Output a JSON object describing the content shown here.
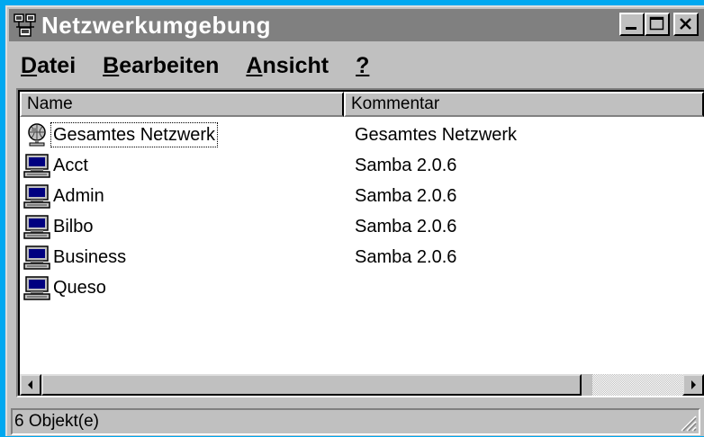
{
  "window": {
    "title": "Netzwerkumgebung",
    "title_icon": "network-neighborhood-icon",
    "buttons": [
      "minimize-icon",
      "maximize-icon",
      "close-icon"
    ]
  },
  "menu": {
    "items": [
      {
        "underline": "D",
        "rest": "atei"
      },
      {
        "underline": "B",
        "rest": "earbeiten"
      },
      {
        "underline": "A",
        "rest": "nsicht"
      },
      {
        "underline": "?",
        "rest": ""
      }
    ]
  },
  "list": {
    "columns": [
      "Name",
      "Kommentar"
    ],
    "rows": [
      {
        "name": "Gesamtes Netzwerk",
        "comment": "Gesamtes Netzwerk",
        "icon": "globe-network-icon"
      },
      {
        "name": "Acct",
        "comment": "Samba 2.0.6",
        "icon": "computer-icon"
      },
      {
        "name": "Admin",
        "comment": "Samba 2.0.6",
        "icon": "computer-icon"
      },
      {
        "name": "Bilbo",
        "comment": "Samba 2.0.6",
        "icon": "computer-icon"
      },
      {
        "name": "Business",
        "comment": "Samba 2.0.6",
        "icon": "computer-icon"
      },
      {
        "name": "Queso",
        "comment": "",
        "icon": "computer-icon"
      }
    ]
  },
  "status": {
    "text": "6 Objekt(e)"
  },
  "colors": {
    "desktop": "#00a8f0",
    "titlebar_inactive": "#808080",
    "face": "#c0c0c0",
    "monitor_screen": "#000080"
  }
}
